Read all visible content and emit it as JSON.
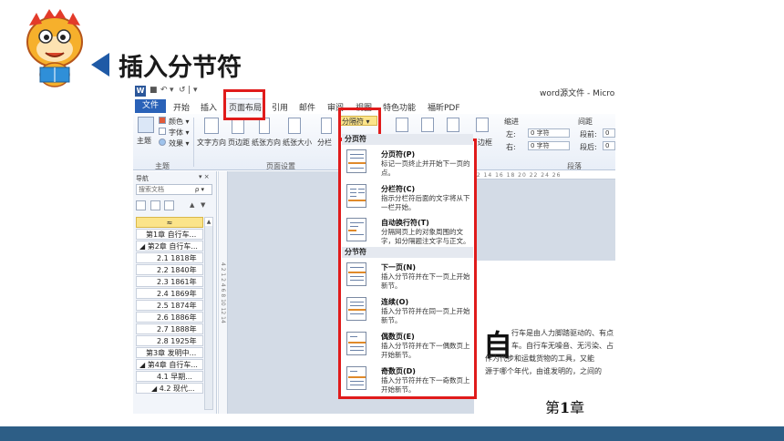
{
  "slide": {
    "title": "插入分节符"
  },
  "window": {
    "doc_title": "word源文件 - Micros",
    "qat_icon": "W",
    "qat_items": [
      "▾",
      "↶",
      "▾",
      "↺",
      "|",
      "▾"
    ]
  },
  "tabs": [
    {
      "label": "文件"
    },
    {
      "label": "开始"
    },
    {
      "label": "插入"
    },
    {
      "label": "页面布局"
    },
    {
      "label": "引用"
    },
    {
      "label": "邮件"
    },
    {
      "label": "审阅"
    },
    {
      "label": "视图"
    },
    {
      "label": "特色功能"
    },
    {
      "label": "福昕PDF"
    }
  ],
  "ribbon": {
    "theme_group": {
      "theme": "主题",
      "colors": "颜色 ▾",
      "fonts": "字体 ▾",
      "effects": "效果 ▾",
      "label": "主题"
    },
    "page_setup": {
      "text_direction": "文字方向",
      "margins": "页边距",
      "orientation": "纸张方向",
      "size": "纸张大小",
      "columns": "分栏",
      "breaks": "分隔符 ▾",
      "label": "页面设置"
    },
    "page_border": "边框",
    "indent": {
      "heading": "缩进",
      "left_label": "左:",
      "left_value": "0 字符",
      "right_label": "右:",
      "right_value": "0 字符"
    },
    "spacing": {
      "heading": "间距",
      "before_label": "段前:",
      "before_value": "0",
      "after_label": "段后:",
      "after_value": "0"
    },
    "paragraph_label": "段落"
  },
  "nav": {
    "header": "导航",
    "close": "▾ ×",
    "search_placeholder": "搜索文档",
    "search_icon": "ρ ▾",
    "up_arrow": "▲",
    "down_arrow": "▼",
    "items": [
      {
        "label": "≈"
      },
      {
        "label": "第1章 自行车..."
      },
      {
        "label": "◢ 第2章 自行车..."
      },
      {
        "label": "2.1  1818年"
      },
      {
        "label": "2.2  1840年"
      },
      {
        "label": "2.3  1861年"
      },
      {
        "label": "2.4  1869年"
      },
      {
        "label": "2.5  1874年"
      },
      {
        "label": "2.6  1886年"
      },
      {
        "label": "2.7  1888年"
      },
      {
        "label": "2.8  1925年"
      },
      {
        "label": "第3章 发明中..."
      },
      {
        "label": "◢ 第4章 自行车..."
      },
      {
        "label": "4.1  早期..."
      },
      {
        "label": "◢ 4.2  现代..."
      }
    ]
  },
  "ruler": {
    "top_ticks": "12 14 16 18 20 22 24 26",
    "side_ticks": "4 2 1 2 4 6 8 10 12 14"
  },
  "document": {
    "drop_cap": "自",
    "lines": [
      "行车是由人力脚踏驱动的、有点",
      "车。自行车无噪音、无污染、占",
      "作为代步和运载货物的工具，又能",
      "源于哪个年代，由谁发明的，之间的"
    ],
    "chapter_prefix": "第",
    "chapter_num": "1",
    "chapter_suffix": "章"
  },
  "menu": {
    "section_page": "分页符",
    "section_break": "分节符",
    "page_breaks": [
      {
        "title": "分页符(P)",
        "desc": "标记一页终止并开始下一页的点。"
      },
      {
        "title": "分栏符(C)",
        "desc": "指示分栏符后面的文字将从下一栏开始。"
      },
      {
        "title": "自动换行符(T)",
        "desc": "分隔网页上的对象周围的文字，如分隔题注文字与正文。"
      }
    ],
    "section_breaks": [
      {
        "title": "下一页(N)",
        "desc": "插入分节符并在下一页上开始新节。"
      },
      {
        "title": "连续(O)",
        "desc": "插入分节符并在同一页上开始新节。"
      },
      {
        "title": "偶数页(E)",
        "desc": "插入分节符并在下一偶数页上开始新节。"
      },
      {
        "title": "奇数页(D)",
        "desc": "插入分节符并在下一奇数页上开始新节。"
      }
    ]
  },
  "colors": {
    "accent_red": "#e01b1b",
    "file_tab_blue": "#2a62b8",
    "footer_bar": "#2d5e86",
    "title_triangle": "#1f5aa6"
  }
}
